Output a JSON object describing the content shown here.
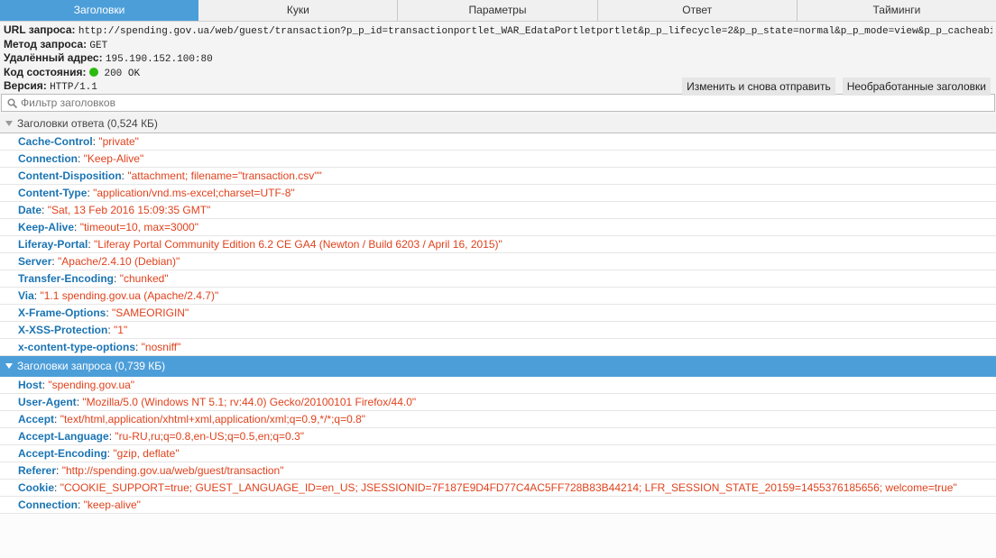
{
  "tabs": [
    "Заголовки",
    "Куки",
    "Параметры",
    "Ответ",
    "Тайминги"
  ],
  "summary": {
    "url_label": "URL запроса:",
    "url": "http://spending.gov.ua/web/guest/transaction?p_p_id=transactionportlet_WAR_EdataPortletportlet&p_p_lifecycle=2&p_p_state=normal&p_p_mode=view&p_p_cacheability=cacheLevel…",
    "method_label": "Метод запроса:",
    "method": "GET",
    "remote_label": "Удалённый адрес:",
    "remote": "195.190.152.100:80",
    "status_label": "Код состояния:",
    "status": "200 OK",
    "status_color": "#2cbb0f",
    "version_label": "Версия:",
    "version": "HTTP/1.1"
  },
  "buttons": {
    "edit_resend": "Изменить и снова отправить",
    "raw_headers": "Необработанные заголовки"
  },
  "filter": {
    "placeholder": "Фильтр заголовков"
  },
  "response": {
    "title": "Заголовки ответа (0,524 КБ)",
    "headers": [
      {
        "name": "Cache-Control",
        "value": "\"private\""
      },
      {
        "name": "Connection",
        "value": "\"Keep-Alive\""
      },
      {
        "name": "Content-Disposition",
        "value": "\"attachment; filename=\"transaction.csv\"\""
      },
      {
        "name": "Content-Type",
        "value": "\"application/vnd.ms-excel;charset=UTF-8\""
      },
      {
        "name": "Date",
        "value": "\"Sat, 13 Feb 2016 15:09:35 GMT\""
      },
      {
        "name": "Keep-Alive",
        "value": "\"timeout=10, max=3000\""
      },
      {
        "name": "Liferay-Portal",
        "value": "\"Liferay Portal Community Edition 6.2 CE GA4 (Newton / Build 6203 / April 16, 2015)\""
      },
      {
        "name": "Server",
        "value": "\"Apache/2.4.10 (Debian)\""
      },
      {
        "name": "Transfer-Encoding",
        "value": "\"chunked\""
      },
      {
        "name": "Via",
        "value": "\"1.1 spending.gov.ua (Apache/2.4.7)\""
      },
      {
        "name": "X-Frame-Options",
        "value": "\"SAMEORIGIN\""
      },
      {
        "name": "X-XSS-Protection",
        "value": "\"1\""
      },
      {
        "name": "x-content-type-options",
        "value": "\"nosniff\""
      }
    ]
  },
  "request": {
    "title": "Заголовки запроса (0,739 КБ)",
    "headers": [
      {
        "name": "Host",
        "value": "\"spending.gov.ua\""
      },
      {
        "name": "User-Agent",
        "value": "\"Mozilla/5.0 (Windows NT 5.1; rv:44.0) Gecko/20100101 Firefox/44.0\""
      },
      {
        "name": "Accept",
        "value": "\"text/html,application/xhtml+xml,application/xml;q=0.9,*/*;q=0.8\""
      },
      {
        "name": "Accept-Language",
        "value": "\"ru-RU,ru;q=0.8,en-US;q=0.5,en;q=0.3\""
      },
      {
        "name": "Accept-Encoding",
        "value": "\"gzip, deflate\""
      },
      {
        "name": "Referer",
        "value": "\"http://spending.gov.ua/web/guest/transaction\""
      },
      {
        "name": "Cookie",
        "value": "\"COOKIE_SUPPORT=true; GUEST_LANGUAGE_ID=en_US; JSESSIONID=7F187E9D4FD77C4AC5FF728B83B44214; LFR_SESSION_STATE_20159=1455376185656; welcome=true\""
      },
      {
        "name": "Connection",
        "value": "\"keep-alive\""
      }
    ]
  }
}
